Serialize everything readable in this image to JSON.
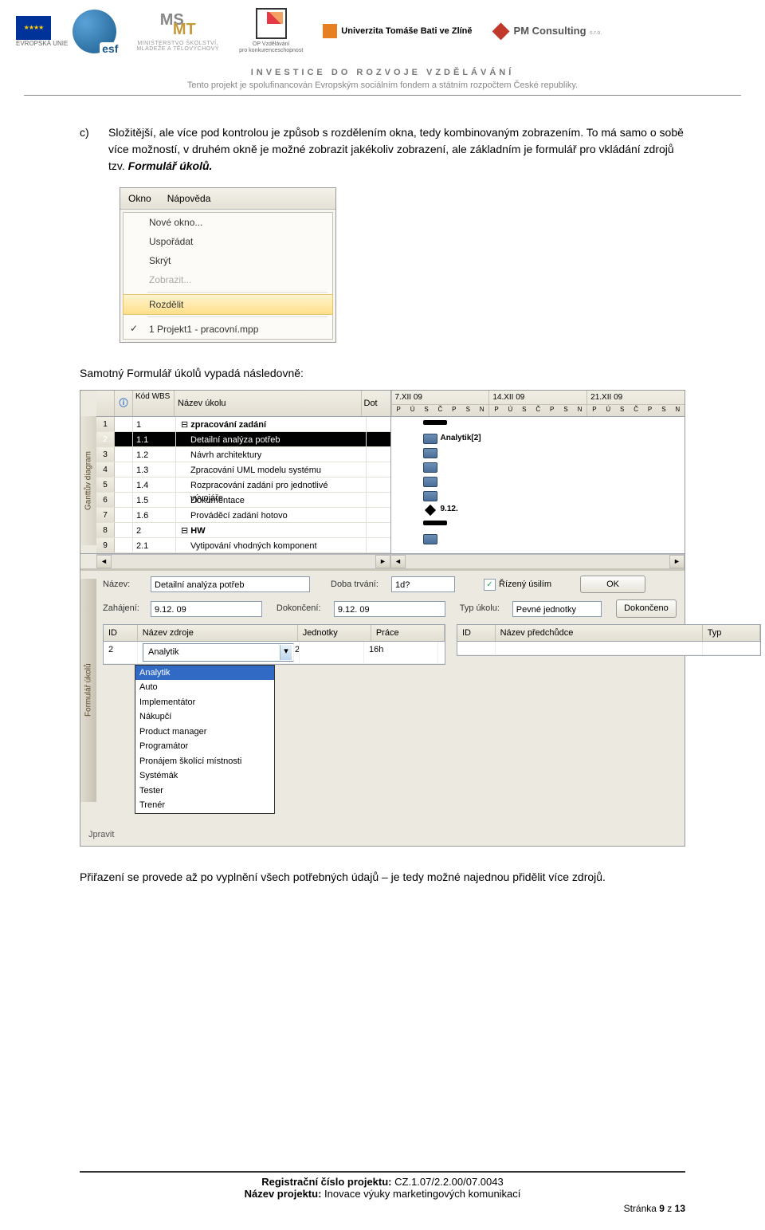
{
  "header": {
    "eu_label": "EVROPSKÁ UNIE",
    "ms_line1": "MINISTERSTVO ŠKOLSTVÍ,",
    "ms_line2": "MLÁDEŽE A TĚLOVÝCHOVY",
    "op_line1": "OP Vzdělávání",
    "op_line2": "pro konkurenceschopnost",
    "utb": "Univerzita Tomáše Bati ve Zlíně",
    "pm": "PM Consulting",
    "pm_sub": "s.r.o.",
    "invest": "INVESTICE DO ROZVOJE VZDĚLÁVÁNÍ",
    "subtitle": "Tento projekt je spolufinancován Evropským sociálním fondem a státním rozpočtem České republiky."
  },
  "body": {
    "bullet": "c)",
    "para1a": "Složitější, ale více pod kontrolou je způsob s rozdělením okna, tedy kombinovaným zobrazením. To má samo o sobě více možností, v druhém okně je možné zobrazit jakékoliv zobrazení, ale základním je formulář pro vkládání zdrojů tzv. ",
    "para1b": "Formulář úkolů.",
    "menu": {
      "bar": [
        "Okno",
        "Nápověda"
      ],
      "items": [
        "Nové okno...",
        "Uspořádat",
        "Skrýt"
      ],
      "disabled": "Zobrazit...",
      "highlight": "Rozdělit",
      "checked": "1 Projekt1 - pracovní.mpp"
    },
    "para2": "Samotný Formulář úkolů vypadá následovně:",
    "gantt": {
      "side": "Ganttův diagram",
      "headers": {
        "info": "ⓘ",
        "wbs": "Kód WBS",
        "name": "Název úkolu",
        "dur": "Dot"
      },
      "weeks": [
        "7.XII 09",
        "14.XII 09",
        "21.XII 09"
      ],
      "days": [
        "S",
        "N",
        "P",
        "Ú",
        "S",
        "Č",
        "P",
        "S",
        "N",
        "P",
        "Ú",
        "S",
        "Č",
        "P",
        "S",
        "N",
        "P",
        "Ú",
        "S",
        "Č",
        "P",
        "S",
        "N"
      ],
      "rows": [
        {
          "n": "1",
          "wbs": "1",
          "name": "zpracování zadání",
          "bold": true
        },
        {
          "n": "2",
          "wbs": "1.1",
          "name": "Detailní analýza potřeb",
          "sel": true
        },
        {
          "n": "3",
          "wbs": "1.2",
          "name": "Návrh architektury"
        },
        {
          "n": "4",
          "wbs": "1.3",
          "name": "Zpracování UML modelu systému"
        },
        {
          "n": "5",
          "wbs": "1.4",
          "name": "Rozpracování zadání pro jednotlivé vývojáře"
        },
        {
          "n": "6",
          "wbs": "1.5",
          "name": "Dokumentace"
        },
        {
          "n": "7",
          "wbs": "1.6",
          "name": "Prováděcí zadání hotovo"
        },
        {
          "n": "8",
          "wbs": "2",
          "name": "HW",
          "bold": true
        },
        {
          "n": "9",
          "wbs": "2.1",
          "name": "Vytipování vhodných komponent"
        }
      ],
      "bar_label": "Analytik[2]",
      "milestone_label": "9.12."
    },
    "form": {
      "side": "Formulář úkolů",
      "r1": {
        "l1": "Název:",
        "v1": "Detailní analýza potřeb",
        "l2": "Doba trvání:",
        "v2": "1d?",
        "chk": "Řízený úsilím",
        "btn": "OK"
      },
      "r2": {
        "l1": "Zahájení:",
        "v1": "9.12. 09",
        "l2": "Dokončení:",
        "v2": "9.12. 09",
        "l3": "Typ úkolu:",
        "v3": "Pevné jednotky",
        "btn": "Dokončeno"
      },
      "t1": {
        "h": [
          "ID",
          "Název zdroje",
          "Jednotky",
          "Práce"
        ],
        "row": [
          "2",
          "Analytik",
          "2",
          "16h"
        ]
      },
      "t2": {
        "h": [
          "ID",
          "Název předchůdce",
          "Typ"
        ]
      },
      "combo": [
        "Analytik",
        "Auto",
        "Implementátor",
        "Nákupčí",
        "Product manager",
        "Programátor",
        "Pronájem školící místnosti",
        "Systémák",
        "Tester",
        "Trenér"
      ],
      "edit": "Jpravit"
    },
    "para3": "Přiřazení se provede až po vyplnění všech potřebných údajů – je tedy možné najednou přidělit více zdrojů."
  },
  "footer": {
    "l1a": "Registrační číslo projektu: ",
    "l1b": "CZ.1.07/2.2.00/07.0043",
    "l2a": "Název projektu: ",
    "l2b": "Inovace výuky marketingových komunikací",
    "page_a": "Stránka ",
    "page_b": "9",
    "page_c": " z ",
    "page_d": "13"
  }
}
